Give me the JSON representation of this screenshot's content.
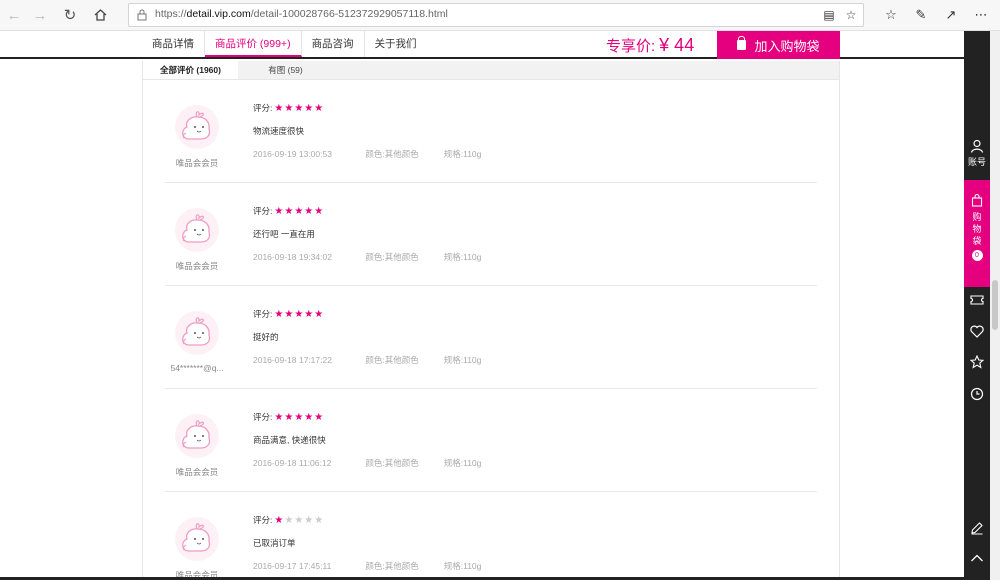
{
  "browser": {
    "url_prefix": "https://",
    "url_host": "detail.vip.com",
    "url_path": "/detail-100028766-512372929057118.html"
  },
  "product_nav": {
    "tabs": [
      {
        "label": "商品详情"
      },
      {
        "label": "商品评价 (999+)"
      },
      {
        "label": "商品咨询"
      },
      {
        "label": "关于我们"
      }
    ],
    "price_label": "专享价:",
    "price_value": "¥ 44",
    "add_to_cart": "加入购物袋"
  },
  "review_tabs": [
    {
      "label": "全部评价 (1960)"
    },
    {
      "label": "有图 (59)"
    }
  ],
  "score_label": "评分:",
  "reviews": [
    {
      "user": "唯品会会员",
      "stars": 5,
      "text": "物流速度很快",
      "date": "2016-09-19 13:00:53",
      "color": "颜色:其他颜色",
      "spec": "规格:110g"
    },
    {
      "user": "唯品会会员",
      "stars": 5,
      "text": "还行吧 一直在用",
      "date": "2016-09-18 19:34:02",
      "color": "颜色:其他颜色",
      "spec": "规格:110g"
    },
    {
      "user": "54*******@q...",
      "stars": 5,
      "text": "挺好的",
      "date": "2016-09-18 17:17:22",
      "color": "颜色:其他颜色",
      "spec": "规格:110g"
    },
    {
      "user": "唯品会会员",
      "stars": 5,
      "text": "商品满意, 快递很快",
      "date": "2016-09-18 11:06:12",
      "color": "颜色:其他颜色",
      "spec": "规格:110g"
    },
    {
      "user": "唯品会会员",
      "stars": 1,
      "text": "已取消订单",
      "date": "2016-09-17 17:45:11",
      "color": "颜色:其他颜色",
      "spec": "规格:110g"
    }
  ],
  "sidebar": {
    "account_label": "账号",
    "cart_label_1": "购",
    "cart_label_2": "物",
    "cart_label_3": "袋",
    "cart_count": "0"
  },
  "colors": {
    "accent": "#e4007f",
    "sidebar": "#222222"
  }
}
